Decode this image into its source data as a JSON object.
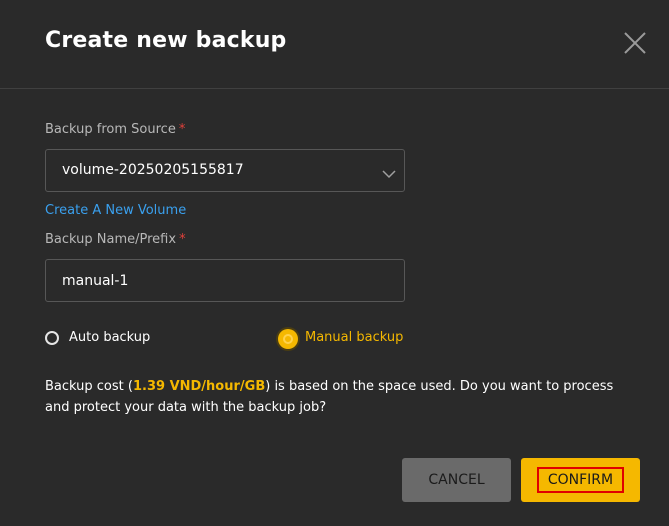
{
  "dialog": {
    "title": "Create new backup",
    "close_icon": "close-icon"
  },
  "source": {
    "label": "Backup from Source",
    "required_mark": "*",
    "value": "volume-20250205155817",
    "chevron_icon": "chevron-down-icon"
  },
  "create_volume_link": "Create A New Volume",
  "name": {
    "label": "Backup Name/Prefix",
    "required_mark": "*",
    "value": "manual-1"
  },
  "backup_type": {
    "options": [
      {
        "label": "Auto backup",
        "selected": false
      },
      {
        "label": "Manual backup",
        "selected": true
      }
    ]
  },
  "description": {
    "prefix": "Backup cost (",
    "cost": "1.39 VND/hour/GB",
    "suffix": ") is based on the space used. Do you want to process and protect your data with the backup job?"
  },
  "buttons": {
    "cancel": "CANCEL",
    "confirm": "CONFIRM"
  },
  "colors": {
    "background": "#2a2a2a",
    "accent": "#f5b800",
    "link": "#3aa0ee",
    "required": "#e0413b",
    "highlight_box": "#e00000"
  }
}
